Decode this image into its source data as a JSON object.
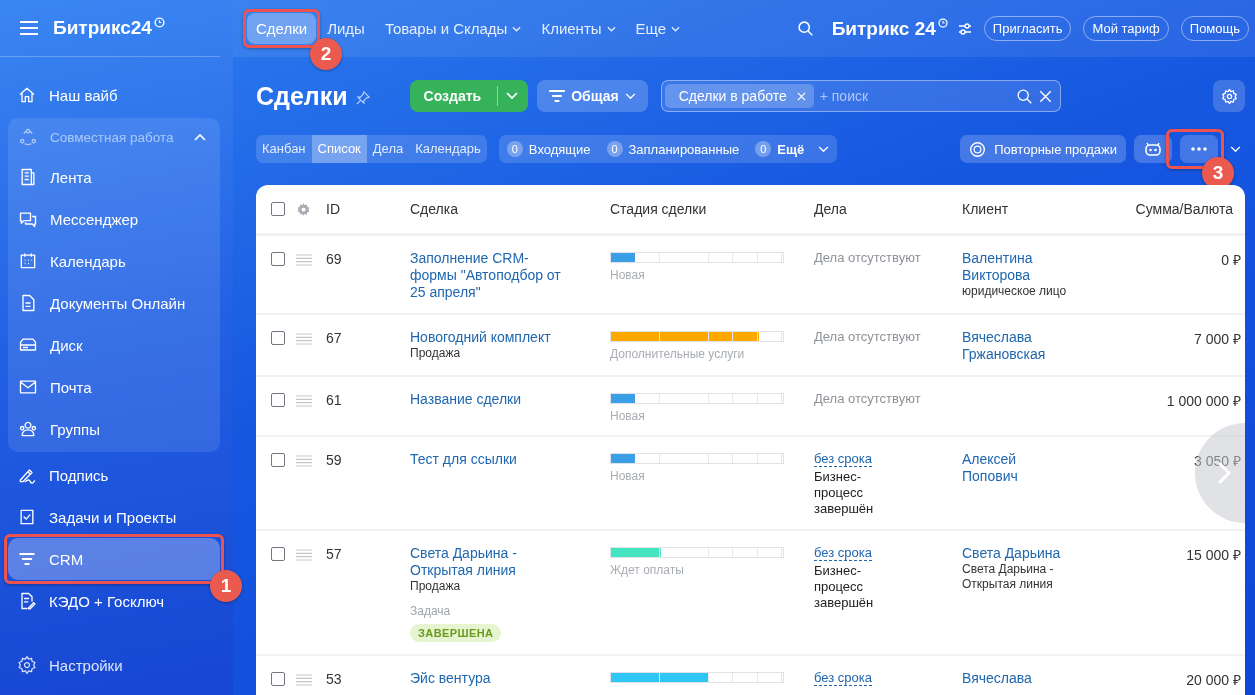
{
  "sidebar": {
    "logo": "Битрикс24",
    "items": [
      {
        "label": "Наш вайб",
        "selected": false
      },
      {
        "label": "Совместная работа",
        "expanded": true,
        "children": [
          {
            "label": "Лента",
            "selected": false
          },
          {
            "label": "Мессенджер",
            "selected": false
          },
          {
            "label": "Календарь",
            "selected": false
          },
          {
            "label": "Документы Онлайн",
            "selected": false
          },
          {
            "label": "Диск",
            "selected": false
          },
          {
            "label": "Почта",
            "selected": false
          },
          {
            "label": "Группы",
            "selected": false
          }
        ]
      },
      {
        "label": "Подпись",
        "selected": false
      },
      {
        "label": "Задачи и Проекты",
        "selected": false
      },
      {
        "label": "CRM",
        "selected": true,
        "callout": "1"
      },
      {
        "label": "КЭДО + Госключ",
        "selected": false
      }
    ],
    "footer": "Настройки"
  },
  "top_nav": {
    "tabs": [
      {
        "label": "Сделки",
        "selected": true,
        "dropdown": false,
        "callout": "2"
      },
      {
        "label": "Лиды",
        "selected": false,
        "dropdown": false
      },
      {
        "label": "Товары и Склады",
        "selected": false,
        "dropdown": true
      },
      {
        "label": "Клиенты",
        "selected": false,
        "dropdown": true
      },
      {
        "label": "Еще",
        "selected": false,
        "dropdown": true
      }
    ],
    "logo": "Битрикс 24",
    "buttons": [
      "Пригласить",
      "Мой тариф",
      "Помощь"
    ]
  },
  "toolbar": {
    "title": "Сделки",
    "create_button": "Создать",
    "filter_button": "Общая",
    "filter_chip": "Сделки в работе",
    "search": {
      "placeholder": "+ поиск"
    }
  },
  "views": [
    {
      "label": "Канбан",
      "selected": false
    },
    {
      "label": "Список",
      "selected": true
    },
    {
      "label": "Дела",
      "selected": false
    },
    {
      "label": "Календарь",
      "selected": false
    }
  ],
  "counters": [
    {
      "count": "0",
      "label": "Входящие",
      "dropdown": false
    },
    {
      "count": "0",
      "label": "Запланированные",
      "dropdown": false
    },
    {
      "count": "0",
      "label": "Ещё",
      "dropdown": true
    }
  ],
  "repeat_sales_button": "Повторные продажи",
  "more_button": {
    "callout": "3"
  },
  "table": {
    "header_checked": false,
    "columns": [
      "ID",
      "Сделка",
      "Стадия сделки",
      "Дела",
      "Клиент",
      "Сумма/Валюта"
    ],
    "rows": [
      {
        "checked": false,
        "id": "69",
        "title": "Заполнение CRM-формы \"Автоподбор от 25 апреля\"",
        "stage": {
          "level": 0.14,
          "color": "#3b9fe8",
          "label": "Новая"
        },
        "activity": {
          "kind": "none",
          "text": "Дела отсутствуют"
        },
        "client": {
          "name": "Валентина Викторова",
          "note": "юридическое лицо"
        },
        "amount": "0 ₽"
      },
      {
        "checked": false,
        "id": "67",
        "title": "Новогодний комплект",
        "subtitle": "Продажа",
        "stage": {
          "level": 0.86,
          "color": "#ffa900",
          "label": "Дополнительные услуги"
        },
        "activity": {
          "kind": "none",
          "text": "Дела отсутствуют"
        },
        "client": {
          "name": "Вячеслава Гржановская"
        },
        "amount": "7 000 ₽"
      },
      {
        "checked": false,
        "id": "61",
        "title": "Название сделки",
        "stage": {
          "level": 0.14,
          "color": "#3b9fe8",
          "label": "Новая"
        },
        "activity": {
          "kind": "none",
          "text": "Дела отсутствуют"
        },
        "amount": "1 000 000 ₽"
      },
      {
        "checked": false,
        "id": "59",
        "title": "Тест для ссылки",
        "stage": {
          "level": 0.14,
          "color": "#3b9fe8",
          "label": "Новая"
        },
        "activity": {
          "kind": "deadline",
          "link": "без срока",
          "note": "Бизнес-процесс завершён"
        },
        "client": {
          "name": "Алексей Попович"
        },
        "amount": "3 050 ₽"
      },
      {
        "checked": false,
        "id": "57",
        "title": "Света Дарьина - Открытая линия",
        "subtitle": "Продажа",
        "task_label": "Задача",
        "task_status": "ЗАВЕРШЕНА",
        "stage": {
          "level": 0.29,
          "color": "#47e4c2",
          "label": "Ждет оплаты"
        },
        "activity": {
          "kind": "deadline",
          "link": "без срока",
          "note": "Бизнес-процесс завершён"
        },
        "client": {
          "name": "Света Дарьина",
          "note": "Света Дарьина - Открытая линия"
        },
        "amount": "15 000 ₽"
      },
      {
        "checked": false,
        "id": "53",
        "title": "Эйс вентура",
        "stage": {
          "level": 0.57,
          "color": "#2fc6f6"
        },
        "activity": {
          "kind": "deadline",
          "link": "без срока"
        },
        "client": {
          "name": "Вячеслава"
        },
        "amount": "20 000 ₽"
      }
    ]
  }
}
